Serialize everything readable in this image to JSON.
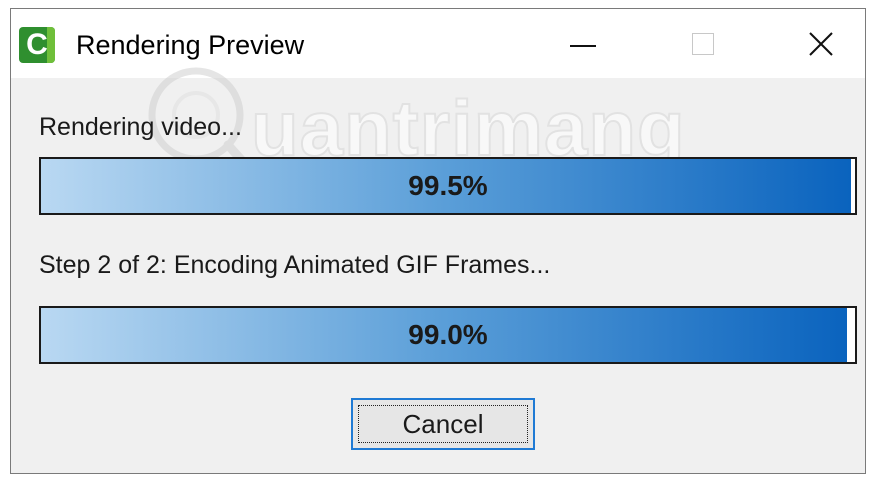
{
  "window": {
    "title": "Rendering Preview",
    "app_icon": "camtasia-icon",
    "controls": [
      "minimize-icon",
      "maximize-icon",
      "close-icon"
    ]
  },
  "watermark": {
    "text": "uantrimang"
  },
  "render": {
    "label": "Rendering video...",
    "progress_text": "99.5%",
    "progress_fraction": 0.995
  },
  "encode": {
    "label": "Step 2 of 2: Encoding Animated GIF Frames...",
    "progress_text": "99.0%",
    "progress_fraction": 0.99
  },
  "buttons": {
    "cancel_label": "Cancel"
  },
  "colors": {
    "progress_start": "#b9d8f2",
    "progress_end": "#0a63be",
    "focus_border": "#1f7ad4"
  }
}
